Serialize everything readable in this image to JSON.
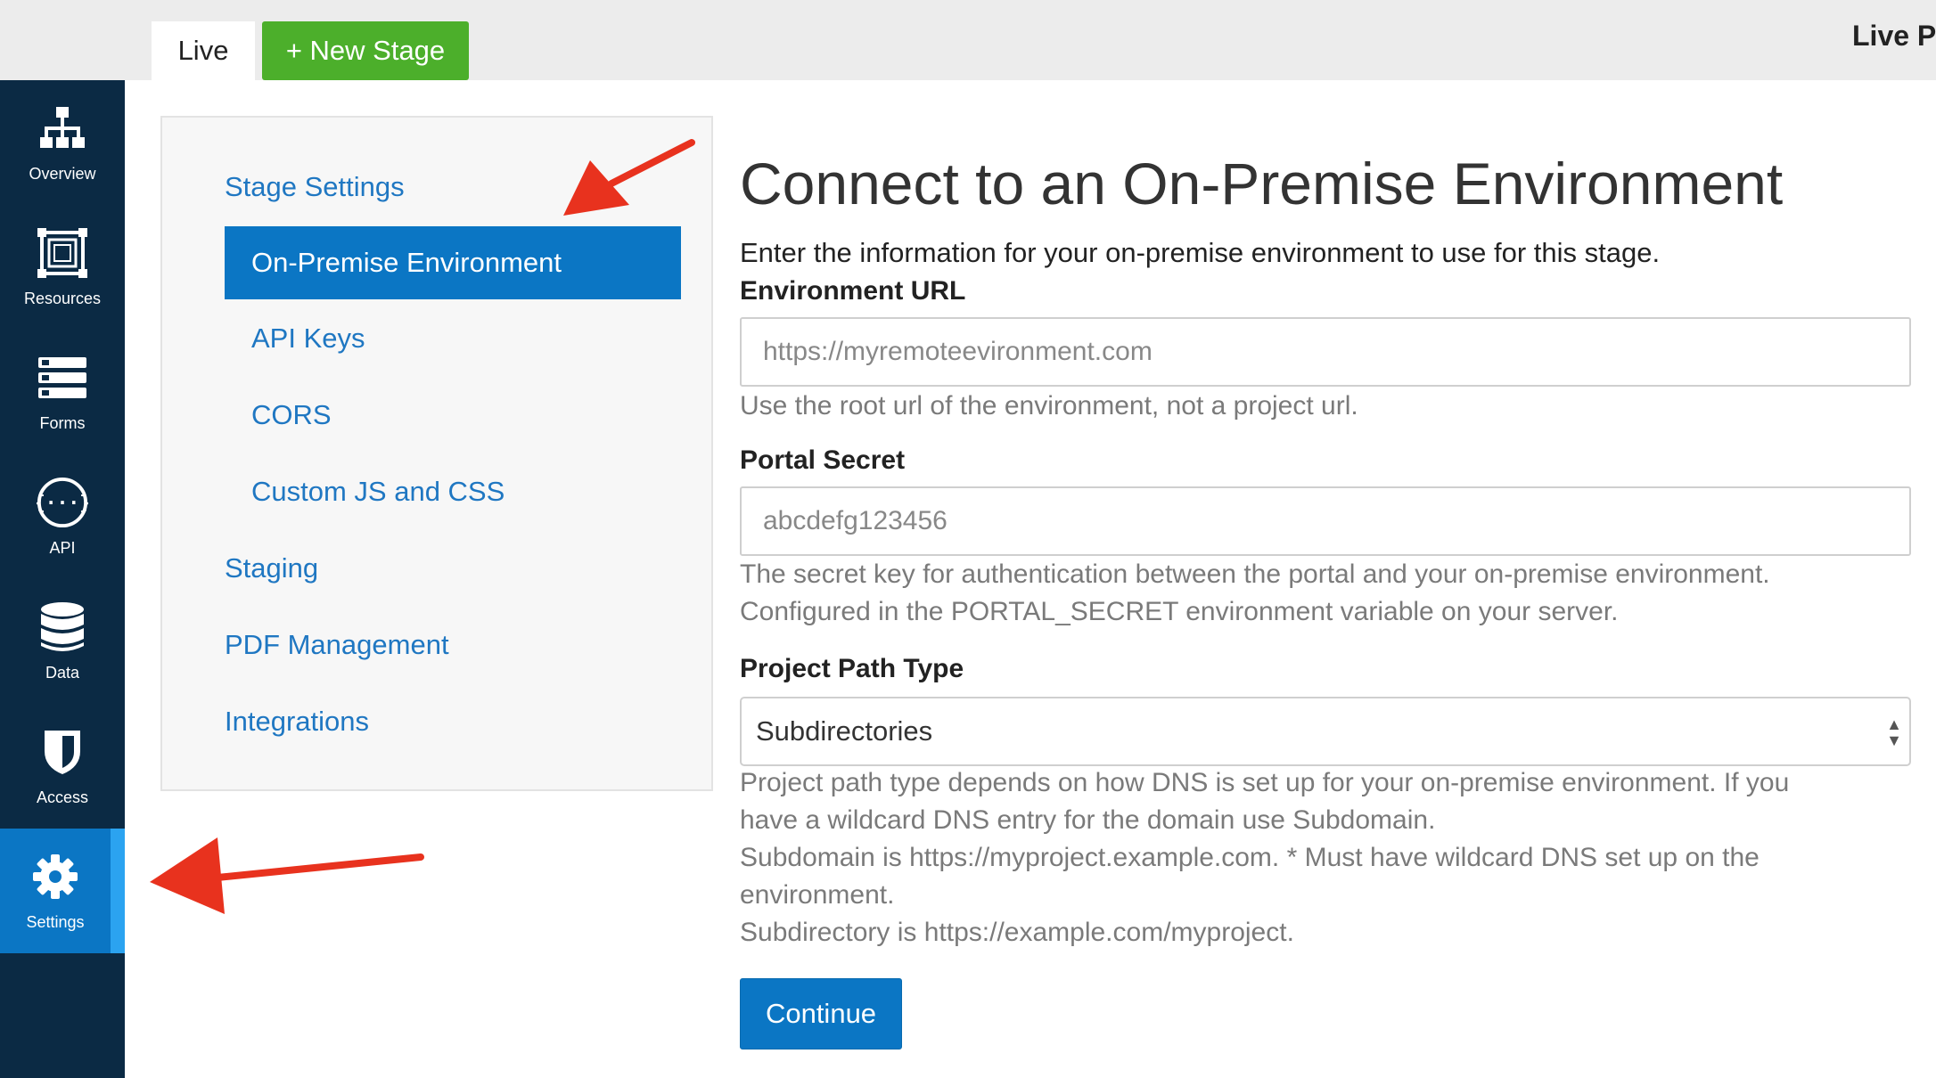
{
  "topbar": {
    "tabs": [
      {
        "label": "Live"
      }
    ],
    "new_stage_label": "+ New Stage",
    "title": "Live Pr"
  },
  "nav": {
    "items": [
      {
        "label": "Overview",
        "icon": "sitemap-icon"
      },
      {
        "label": "Resources",
        "icon": "resources-icon"
      },
      {
        "label": "Forms",
        "icon": "forms-icon"
      },
      {
        "label": "API",
        "icon": "api-icon"
      },
      {
        "label": "Data",
        "icon": "database-icon"
      },
      {
        "label": "Access",
        "icon": "shield-icon"
      },
      {
        "label": "Settings",
        "icon": "gear-icon",
        "active": true
      }
    ]
  },
  "settings_menu": {
    "stage_settings": "Stage Settings",
    "items": [
      "On-Premise Environment",
      "API Keys",
      "CORS",
      "Custom JS and CSS"
    ],
    "active_item": "On-Premise Environment",
    "staging": "Staging",
    "pdf_management": "PDF Management",
    "integrations": "Integrations"
  },
  "main": {
    "title": "Connect to an On-Premise Environment",
    "intro": "Enter the information for your on-premise environment to use for this stage.",
    "env_url": {
      "label": "Environment URL",
      "value": "",
      "placeholder": "https://myremoteevironment.com",
      "help": "Use the root url of the environment, not a project url."
    },
    "portal_secret": {
      "label": "Portal Secret",
      "value": "",
      "placeholder": "abcdefg123456",
      "help": [
        "The secret key for authentication between the portal and your on-premise environment.",
        "Configured in the PORTAL_SECRET environment variable on your server."
      ]
    },
    "project_path_type": {
      "label": "Project Path Type",
      "selected": "Subdirectories",
      "help": [
        "Project path type depends on how DNS is set up for your on-premise environment. If you",
        "have a wildcard DNS entry for the domain use Subdomain.",
        "Subdomain is https://myproject.example.com. * Must have wildcard DNS set up on the",
        "environment.",
        "Subdirectory is https://example.com/myproject."
      ]
    },
    "continue_label": "Continue"
  },
  "colors": {
    "nav_bg": "#0b2a44",
    "accent_blue": "#0b76c4",
    "new_stage_green": "#4caf2b",
    "annotation_red": "#e8321e"
  }
}
